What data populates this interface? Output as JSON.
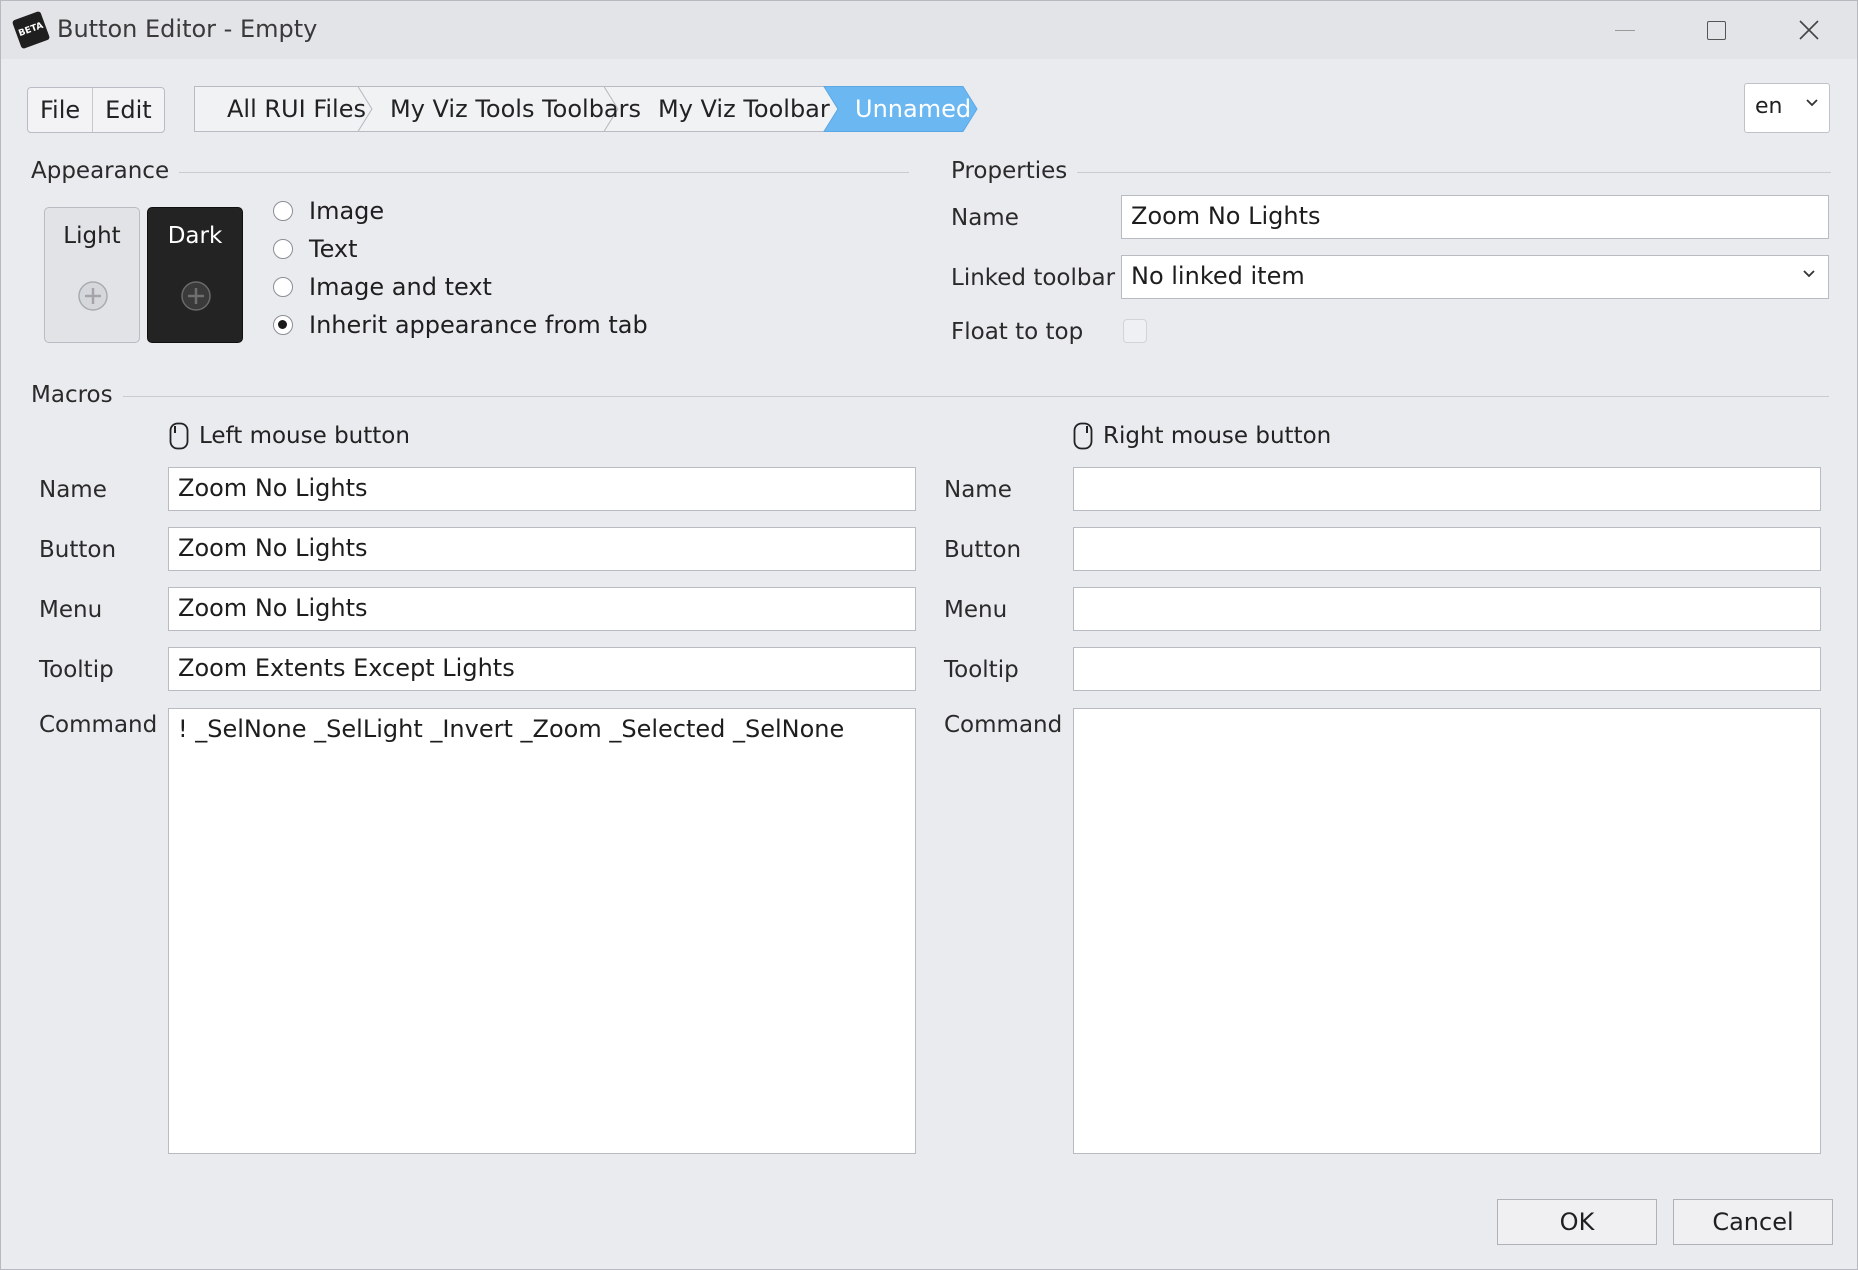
{
  "window": {
    "title": "Button Editor - Empty",
    "app_icon_text": "BETA"
  },
  "menu": {
    "items": [
      "File",
      "Edit"
    ]
  },
  "breadcrumb": {
    "items": [
      "All RUI Files",
      "My Viz Tools Toolbars",
      "My Viz Toolbar",
      "Unnamed"
    ],
    "active_index": 3,
    "active_color": "#6bb7f2"
  },
  "language": {
    "value": "en"
  },
  "appearance": {
    "title": "Appearance",
    "tiles": {
      "light": "Light",
      "dark": "Dark"
    },
    "options": [
      "Image",
      "Text",
      "Image and text",
      "Inherit appearance from tab"
    ],
    "selected": "Inherit appearance from tab"
  },
  "properties": {
    "title": "Properties",
    "name_label": "Name",
    "name_value": "Zoom No Lights",
    "linked_toolbar_label": "Linked toolbar",
    "linked_toolbar_value": "No linked item",
    "float_to_top_label": "Float to top",
    "float_to_top_checked": false
  },
  "macros": {
    "title": "Macros",
    "left": {
      "header": "Left mouse button",
      "name_label": "Name",
      "name_value": "Zoom No Lights",
      "button_label": "Button",
      "button_value": "Zoom No Lights",
      "menu_label": "Menu",
      "menu_value": "Zoom No Lights",
      "tooltip_label": "Tooltip",
      "tooltip_value": "Zoom Extents Except Lights",
      "command_label": "Command",
      "command_value": "! _SelNone _SelLight _Invert _Zoom _Selected _SelNone"
    },
    "right": {
      "header": "Right mouse button",
      "name_label": "Name",
      "name_value": "",
      "button_label": "Button",
      "button_value": "",
      "menu_label": "Menu",
      "menu_value": "",
      "tooltip_label": "Tooltip",
      "tooltip_value": "",
      "command_label": "Command",
      "command_value": ""
    }
  },
  "footer": {
    "ok_label": "OK",
    "cancel_label": "Cancel"
  }
}
